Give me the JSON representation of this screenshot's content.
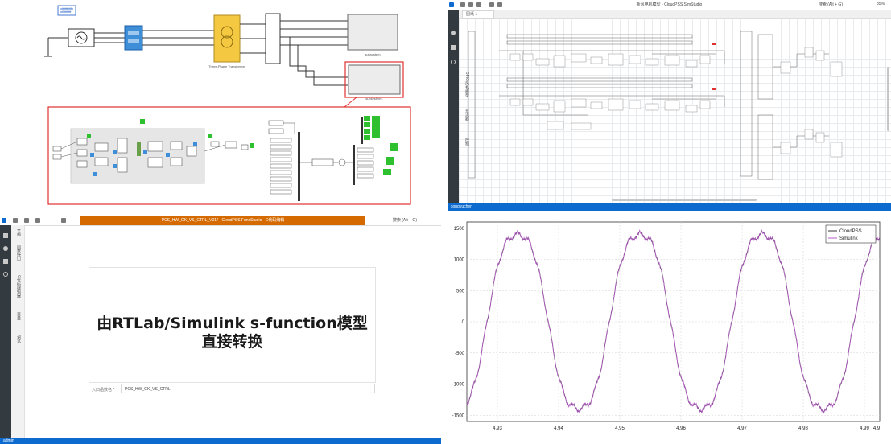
{
  "simulink": {
    "corner_label": "powergui\nDiscrete",
    "transformer_label": "Three-Phase Transformer",
    "block_label_a": "subsystem",
    "block_label_b": "subsystem1"
  },
  "cloudpss": {
    "window_title": "新风电机模型 - CloudPSS SimStudio",
    "tab_label": "图纸 1",
    "zoom": "35%",
    "search_placeholder": "搜索 (Alt + G)",
    "status_user": "songyuchen",
    "row_labels": [
      "DFIG风机模型",
      "变流器",
      "控制"
    ]
  },
  "function_editor": {
    "window_title": "PCS_HW_GK_VS_CTRL_V01* - CloudPSS FuncStudio - C代码编辑",
    "search_placeholder": "搜索 (Alt + G)",
    "vertical_tabs": [
      "文档",
      "函数接口",
      "C代码编辑器",
      "变量",
      "调试"
    ],
    "headline_line1": "由RTLab/Simulink s-function模型",
    "headline_line2": "直接转换",
    "entry_label": "入口函数名 *",
    "entry_value": "PCS_HW_GK_VS_CTRL",
    "status_user": "admin"
  },
  "chart_data": {
    "type": "line",
    "x_ticks": [
      "4.93",
      "4.94",
      "4.95",
      "4.96",
      "4.97",
      "4.98",
      "4.99",
      "4.9"
    ],
    "y_ticks": [
      "1500",
      "1000",
      "500",
      "0",
      "-500",
      "-1000",
      "-1500"
    ],
    "xlim": [
      4.925,
      4.9925
    ],
    "ylim": [
      -1600,
      1600
    ],
    "grid": true,
    "legend_position": "top-right",
    "series": [
      {
        "name": "CloudPSS",
        "color": "#333333"
      },
      {
        "name": "Simulink",
        "color": "#b05fc0"
      }
    ],
    "period": 0.02,
    "amplitude": 1500,
    "phase_peak_x": 4.9333,
    "harmonic_ratio": 0.07
  },
  "colors": {
    "accent_blue": "#0d6bd0",
    "orange": "#d46a00",
    "highlight_red": "#e03030",
    "block_green": "#2fc02f",
    "transformer_yellow": "#f5c842"
  }
}
